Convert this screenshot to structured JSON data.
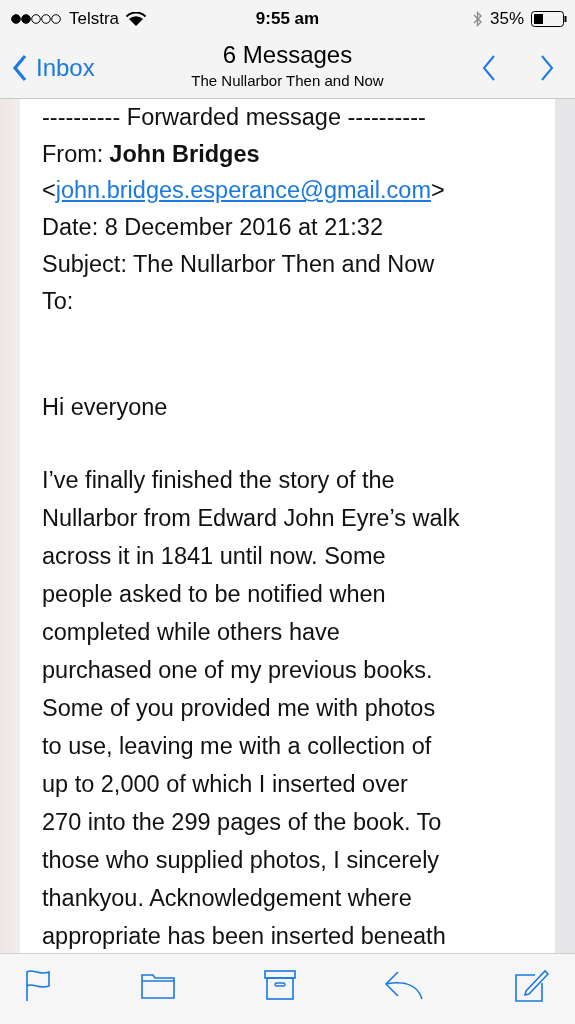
{
  "status_bar": {
    "carrier": "Telstra",
    "time": "9:55 am",
    "battery": "35%"
  },
  "nav": {
    "back": "Inbox",
    "title": "6 Messages",
    "subtitle": "The Nullarbor Then and Now"
  },
  "header": {
    "separator": "---------- Forwarded message ----------",
    "from_label": "From:",
    "from_name": "John Bridges",
    "email_open": "<",
    "from_email": "john.bridges.esperance@gmail.com",
    "email_close": ">",
    "date": "Date: 8 December 2016 at 21:32",
    "subject": "Subject: The Nullarbor Then and Now",
    "to": "To:"
  },
  "greeting": "Hi everyone",
  "body_lines": [
    "I’ve finally finished the story of the",
    "Nullarbor from Edward John Eyre’s walk",
    "across it in 1841 until now.  Some",
    "people asked to be notified when",
    "completed while others have",
    "purchased one of my previous books.",
    "Some of you provided me with photos",
    "to use, leaving me with a collection of",
    "up to 2,000 of which I inserted over",
    "270 into the 299 pages of the book.  To",
    "those who supplied photos, I sincerely",
    "thankyou.  Acknowledgement where",
    "appropriate has been inserted beneath"
  ]
}
